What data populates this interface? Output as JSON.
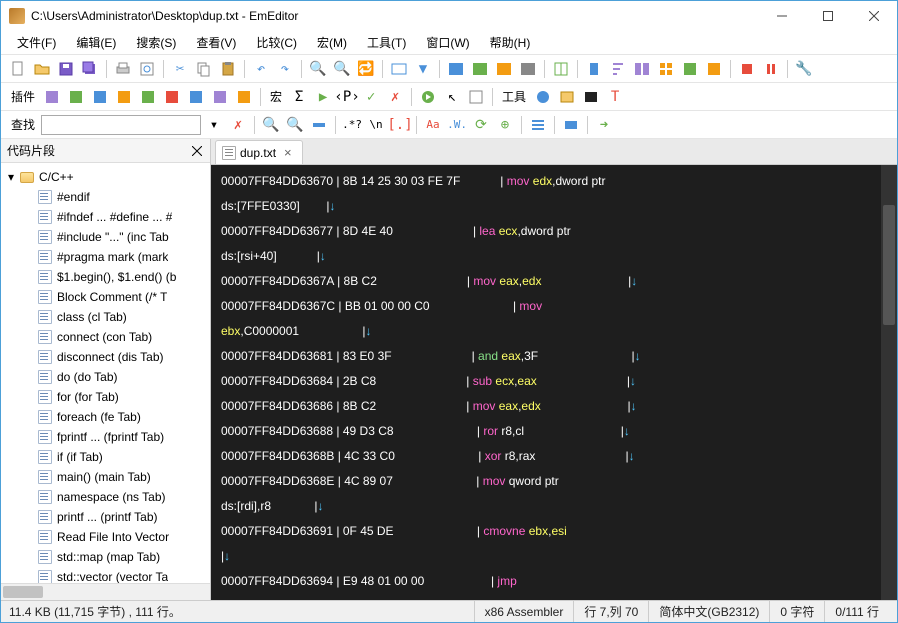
{
  "window": {
    "title": "C:\\Users\\Administrator\\Desktop\\dup.txt - EmEditor"
  },
  "menu": {
    "file": "文件(F)",
    "edit": "编辑(E)",
    "search": "搜索(S)",
    "view": "查看(V)",
    "compare": "比较(C)",
    "macro": "宏(M)",
    "tools": "工具(T)",
    "window": "窗口(W)",
    "help": "帮助(H)"
  },
  "toolbar_labels": {
    "plugins": "插件",
    "macro": "宏",
    "tools": "工具",
    "find": "查找"
  },
  "snippets": {
    "title": "代码片段",
    "root": "C/C++",
    "items": [
      "#endif",
      "#ifndef ... #define ... #",
      "#include \"...\"  (inc Tab",
      "#pragma mark  (mark",
      "$1.begin(), $1.end()  (b",
      "Block Comment  (/* T",
      "class  (cl Tab)",
      "connect  (con Tab)",
      "disconnect  (dis Tab)",
      "do  (do Tab)",
      "for  (for Tab)",
      "foreach  (fe Tab)",
      "fprintf ...  (fprintf Tab)",
      "if  (if Tab)",
      "main()  (main Tab)",
      "namespace  (ns Tab)",
      "printf ...  (printf Tab)",
      "Read File Into Vector",
      "std::map  (map Tab)",
      "std::vector  (vector Ta"
    ]
  },
  "tab": {
    "name": "dup.txt"
  },
  "code": [
    [
      [
        "addr",
        "00007FF84DD63670 "
      ],
      [
        "pipe",
        "| "
      ],
      [
        "hex",
        "8B 14 25 30 03 FE 7F            "
      ],
      [
        "pipe",
        "| "
      ],
      [
        "op",
        "mov "
      ],
      [
        "reg",
        "edx"
      ],
      [
        "mem",
        ",dword ptr"
      ]
    ],
    [
      [
        "mem",
        "ds:[7FFE0330]        "
      ],
      [
        "pipe",
        "|"
      ],
      [
        "arrow",
        "↓"
      ]
    ],
    [
      [
        "addr",
        "00007FF84DD63677 "
      ],
      [
        "pipe",
        "| "
      ],
      [
        "hex",
        "8D 4E 40                        "
      ],
      [
        "pipe",
        "| "
      ],
      [
        "op",
        "lea "
      ],
      [
        "reg",
        "ecx"
      ],
      [
        "mem",
        ",dword ptr"
      ]
    ],
    [
      [
        "mem",
        "ds:[rsi+40]            "
      ],
      [
        "pipe",
        "|"
      ],
      [
        "arrow",
        "↓"
      ]
    ],
    [
      [
        "addr",
        "00007FF84DD6367A "
      ],
      [
        "pipe",
        "| "
      ],
      [
        "hex",
        "8B C2                           "
      ],
      [
        "pipe",
        "| "
      ],
      [
        "op",
        "mov "
      ],
      [
        "reg",
        "eax"
      ],
      [
        "mem",
        ","
      ],
      [
        "reg",
        "edx"
      ],
      [
        "mem",
        "                          "
      ],
      [
        "pipe",
        "|"
      ],
      [
        "arrow",
        "↓"
      ]
    ],
    [
      [
        "addr",
        "00007FF84DD6367C "
      ],
      [
        "pipe",
        "| "
      ],
      [
        "hex",
        "BB 01 00 00 C0                  "
      ],
      [
        "pipe",
        "       | "
      ],
      [
        "op",
        "mov"
      ]
    ],
    [
      [
        "reg",
        "ebx"
      ],
      [
        "mem",
        ",C0000001                   "
      ],
      [
        "pipe",
        "|"
      ],
      [
        "arrow",
        "↓"
      ]
    ],
    [
      [
        "addr",
        "00007FF84DD63681 "
      ],
      [
        "pipe",
        "| "
      ],
      [
        "hex",
        "83 E0 3F                        "
      ],
      [
        "pipe",
        "| "
      ],
      [
        "and",
        "and "
      ],
      [
        "reg",
        "eax"
      ],
      [
        "mem",
        ",3F                            "
      ],
      [
        "pipe",
        "|"
      ],
      [
        "arrow",
        "↓"
      ]
    ],
    [
      [
        "addr",
        "00007FF84DD63684 "
      ],
      [
        "pipe",
        "| "
      ],
      [
        "hex",
        "2B C8                           "
      ],
      [
        "pipe",
        "| "
      ],
      [
        "op",
        "sub "
      ],
      [
        "reg",
        "ecx"
      ],
      [
        "mem",
        ","
      ],
      [
        "reg",
        "eax"
      ],
      [
        "mem",
        "                           "
      ],
      [
        "pipe",
        "|"
      ],
      [
        "arrow",
        "↓"
      ]
    ],
    [
      [
        "addr",
        "00007FF84DD63686 "
      ],
      [
        "pipe",
        "| "
      ],
      [
        "hex",
        "8B C2                           "
      ],
      [
        "pipe",
        "| "
      ],
      [
        "op",
        "mov "
      ],
      [
        "reg",
        "eax"
      ],
      [
        "mem",
        ","
      ],
      [
        "reg",
        "edx"
      ],
      [
        "mem",
        "                          "
      ],
      [
        "pipe",
        "|"
      ],
      [
        "arrow",
        "↓"
      ]
    ],
    [
      [
        "addr",
        "00007FF84DD63688 "
      ],
      [
        "pipe",
        "| "
      ],
      [
        "hex",
        "49 D3 C8                        "
      ],
      [
        "pipe",
        " | "
      ],
      [
        "op",
        "ror "
      ],
      [
        "mem",
        "r8,cl                             "
      ],
      [
        "pipe",
        "|"
      ],
      [
        "arrow",
        "↓"
      ]
    ],
    [
      [
        "addr",
        "00007FF84DD6368B "
      ],
      [
        "pipe",
        "| "
      ],
      [
        "hex",
        "4C 33 C0                        "
      ],
      [
        "pipe",
        " | "
      ],
      [
        "op",
        "xor "
      ],
      [
        "mem",
        "r8,rax                           "
      ],
      [
        "pipe",
        "|"
      ],
      [
        "arrow",
        "↓"
      ]
    ],
    [
      [
        "addr",
        "00007FF84DD6368E "
      ],
      [
        "pipe",
        "| "
      ],
      [
        "hex",
        "4C 89 07                        "
      ],
      [
        "pipe",
        " | "
      ],
      [
        "op",
        "mov "
      ],
      [
        "mem",
        "qword ptr"
      ]
    ],
    [
      [
        "mem",
        "ds:[rdi],r8             "
      ],
      [
        "pipe",
        "|"
      ],
      [
        "arrow",
        "↓"
      ]
    ],
    [
      [
        "addr",
        "00007FF84DD63691 "
      ],
      [
        "pipe",
        "| "
      ],
      [
        "hex",
        "0F 45 DE                        "
      ],
      [
        "pipe",
        " | "
      ],
      [
        "op",
        "cmovne "
      ],
      [
        "reg",
        "ebx"
      ],
      [
        "mem",
        ","
      ],
      [
        "reg",
        "esi"
      ]
    ],
    [
      [
        "pipe",
        "|"
      ],
      [
        "arrow",
        "↓"
      ]
    ],
    [
      [
        "addr",
        "00007FF84DD63694 "
      ],
      [
        "pipe",
        "| "
      ],
      [
        "hex",
        "E9 48 01 00 00                  "
      ],
      [
        "pipe",
        "  | "
      ],
      [
        "op",
        "jmp"
      ]
    ]
  ],
  "status": {
    "size": "11.4 KB (11,715 字节) , 111 行。",
    "lang": "x86 Assembler",
    "pos": "行 7,列 70",
    "enc": "简体中文(GB2312)",
    "chars": "0 字符",
    "lines": "0/111 行"
  }
}
